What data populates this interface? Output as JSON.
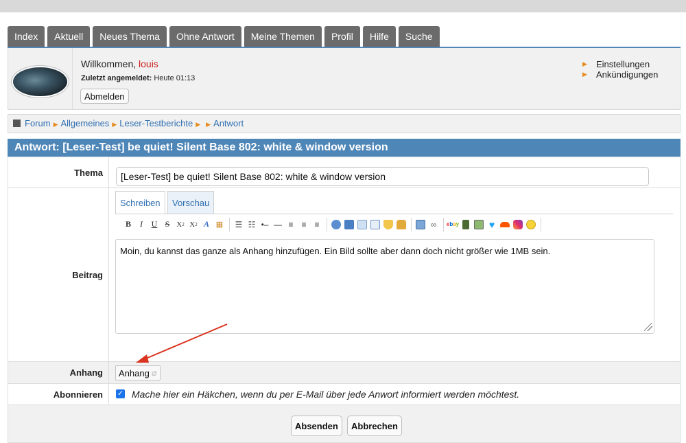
{
  "tabs": [
    "Index",
    "Aktuell",
    "Neues Thema",
    "Ohne Antwort",
    "Meine Themen",
    "Profil",
    "Hilfe",
    "Suche"
  ],
  "user": {
    "welcome_prefix": "Willkommen, ",
    "username": "louis",
    "last_login_label": "Zuletzt angemeldet:",
    "last_login_value": " Heute 01:13",
    "logout_label": "Abmelden"
  },
  "right_links": [
    "Einstellungen",
    "Ankündigungen"
  ],
  "breadcrumb": [
    "Forum",
    "Allgemeines",
    "Leser-Testberichte",
    "",
    "Antwort"
  ],
  "page_title": "Antwort: [Leser-Test] be quiet! Silent Base 802: white & window version",
  "form": {
    "thema_label": "Thema",
    "thema_value": "[Leser-Test] be quiet! Silent Base 802: white & window version",
    "beitrag_label": "Beitrag",
    "editor_tabs": [
      "Schreiben",
      "Vorschau"
    ],
    "beitrag_value": "Moin, du kannst das ganze als Anhang hinzufügen. Ein Bild sollte aber dann doch nicht größer wie 1MB sein.",
    "anhang_label": "Anhang",
    "anhang_button": "Anhang",
    "abo_label": "Abonnieren",
    "abo_text": "Mache hier ein Häkchen, wenn du per E-Mail über jede Anwort informiert werden möchtest.",
    "abo_checked": true,
    "submit_label": "Absenden",
    "cancel_label": "Abbrechen"
  },
  "toolbar_icons": [
    "bold-icon",
    "italic-icon",
    "underline-icon",
    "strikethrough-icon",
    "subscript-icon",
    "superscript-icon",
    "font-color-icon",
    "color-grid-icon",
    "unordered-list-icon",
    "ordered-list-icon",
    "list-item-icon",
    "horizontal-rule-icon",
    "align-left-icon",
    "align-center-icon",
    "align-right-icon",
    "quote-icon",
    "quote-user-icon",
    "code-icon",
    "spoiler-icon",
    "shield-icon",
    "lock-icon",
    "image-icon",
    "link-icon",
    "ebay-icon",
    "video-icon",
    "gallery-icon",
    "twitter-icon",
    "soundcloud-icon",
    "instagram-icon",
    "smiley-icon"
  ],
  "colors": {
    "accent": "#4f86b8",
    "tab_bg": "#6b6b6b",
    "link": "#2f6fb0",
    "username": "#cc1f1f",
    "arrow": "#d9341f"
  }
}
